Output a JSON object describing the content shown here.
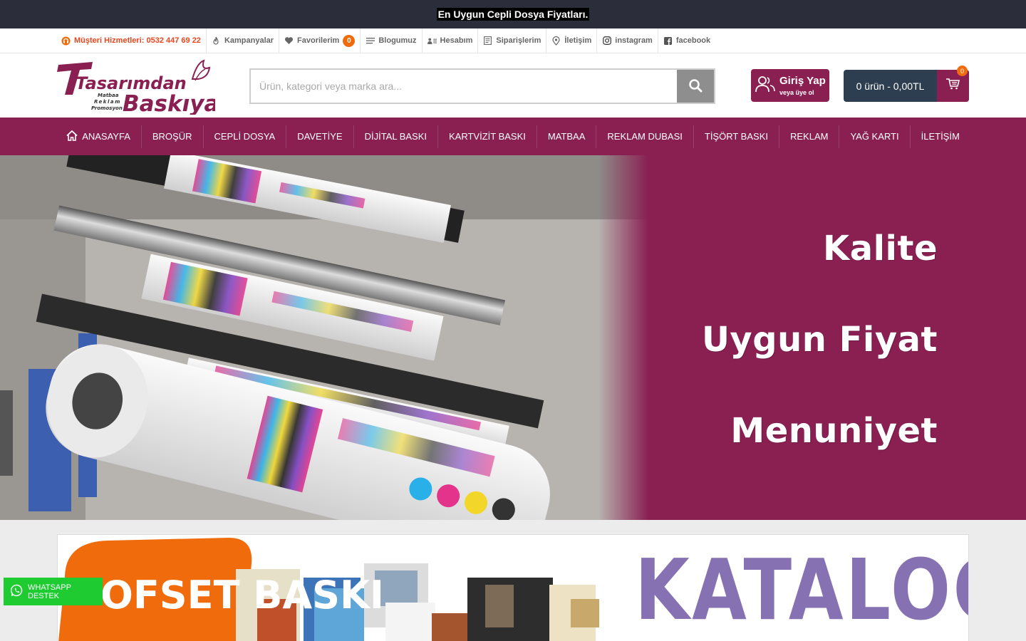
{
  "announcement": "En Uygun Cepli Dosya Fiyatları.",
  "topbar": {
    "support": "Müşteri Hizmetleri: 0532 447 69 22",
    "campaigns": "Kampanyalar",
    "favorites": "Favorilerim",
    "favorites_count": "0",
    "blog": "Blogumuz",
    "account": "Hesabım",
    "orders": "Siparişlerim",
    "contact": "İletişim",
    "instagram": "instagram",
    "facebook": "facebook"
  },
  "logo": {
    "line1": "Tasarımdan",
    "line2": "Baskıya",
    "tag1": "Matbaa",
    "tag2": "Reklam",
    "tag3": "Promosyon"
  },
  "search": {
    "placeholder": "Ürün, kategori veya marka ara...",
    "value": ""
  },
  "login": {
    "title": "Giriş Yap",
    "subtitle": "veya üye ol"
  },
  "cart": {
    "summary": "0 ürün - 0,00TL",
    "count": "0"
  },
  "nav": [
    "ANASAYFA",
    "BROŞÜR",
    "CEPLİ DOSYA",
    "DAVETİYE",
    "DİJİTAL BASKI",
    "KARTVİZİT BASKI",
    "MATBAA",
    "REKLAM DUBASI",
    "TİŞÖRT BASKI",
    "REKLAM",
    "YAĞ KARTI",
    "İLETİŞİM"
  ],
  "hero": {
    "word1": "Kalite",
    "word2": "Uygun Fiyat",
    "word3": "Menuniyet"
  },
  "banner2": {
    "title": "KATALOG",
    "badge": "OFSET BASKI"
  },
  "whatsapp": "WHATSAPP DESTEK",
  "colors": {
    "primary": "#8a1f52",
    "dark": "#2b2e3a",
    "cart": "#2d3e50",
    "accent": "#f06b0c",
    "whatsapp": "#1ecb31",
    "katalog": "#8672b2"
  }
}
